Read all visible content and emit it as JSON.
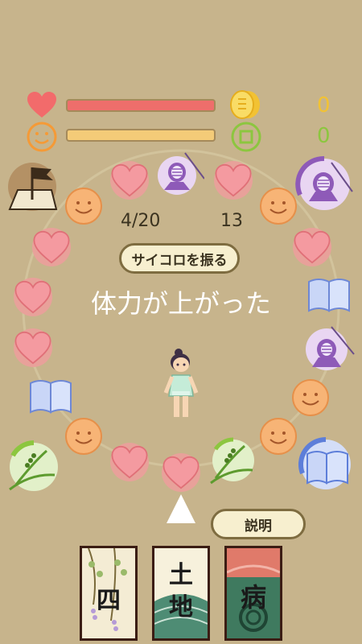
{
  "stats": {
    "coin_value": "0",
    "token_value": "0",
    "heart_fill": 1.0,
    "smile_fill": 1.0
  },
  "board": {
    "progress_label": "4/20",
    "dice_count": "13",
    "roll_button_label": "サイコロを振る",
    "message": "体力が上がった"
  },
  "explain_button_label": "説明",
  "cards": [
    {
      "kanji": "四"
    },
    {
      "kanji": "土地"
    },
    {
      "kanji": "病"
    }
  ],
  "colors": {
    "heart": "#f26b6b",
    "smile": "#f59a36",
    "coin": "#f2c233",
    "token": "#8cc63f",
    "background": "#c7b48c",
    "purple": "#8e5ab8",
    "blue": "#5d7ed9"
  }
}
